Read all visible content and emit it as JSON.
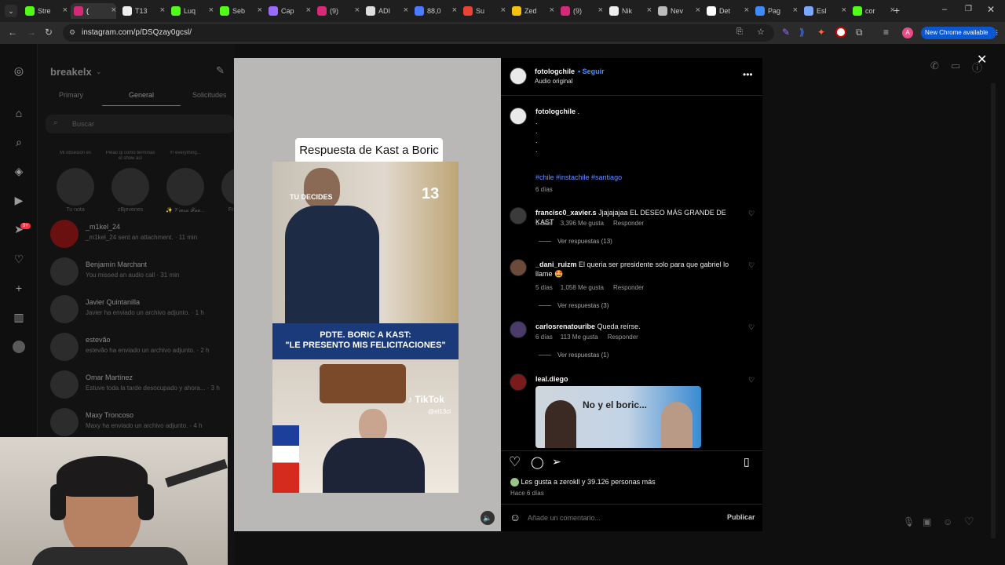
{
  "browser": {
    "tabs": [
      {
        "label": "Stre",
        "color": "#53fc18"
      },
      {
        "label": "(",
        "color": "#d62976",
        "active": true
      },
      {
        "label": "T13",
        "color": "#eeeeee"
      },
      {
        "label": "Luq",
        "color": "#53fc18"
      },
      {
        "label": "Seb",
        "color": "#53fc18"
      },
      {
        "label": "Cap",
        "color": "#9b6bff"
      },
      {
        "label": "(9)",
        "color": "#d62976"
      },
      {
        "label": "ADI",
        "color": "#dddddd"
      },
      {
        "label": "88,0",
        "color": "#4b7bff"
      },
      {
        "label": "Su",
        "color": "#ea4335"
      },
      {
        "label": "Zed",
        "color": "#f4c20d"
      },
      {
        "label": "(9)",
        "color": "#d62976"
      },
      {
        "label": "Nik",
        "color": "#eeeeee"
      },
      {
        "label": "Nev",
        "color": "#bbbbbb"
      },
      {
        "label": "Det",
        "color": "#ffffff"
      },
      {
        "label": "Pag",
        "color": "#3d8bfd"
      },
      {
        "label": "Esl",
        "color": "#7aa7ff"
      },
      {
        "label": "cor",
        "color": "#53fc18"
      }
    ],
    "url": "instagram.com/p/DSQzay0gcsl/",
    "new_chrome": "New Chrome available",
    "profile_initial": "A"
  },
  "inbox": {
    "account": "breakelx",
    "tabs": [
      "Primary",
      "General",
      "Solicitudes"
    ],
    "search_placeholder": "Buscar",
    "notes": [
      {
        "note": "Mi obsesión es",
        "name": "Tu nota"
      },
      {
        "note": "Pelao qi como terminas el show así",
        "name": "zBjevenes"
      },
      {
        "note": "!!! everything...",
        "name": "✨ 𝓥𝓲𝓮𝓻𝓪 𝓕𝓪𝓮..."
      },
      {
        "note": "Soy u",
        "name": "Francisco"
      }
    ],
    "conversations": [
      {
        "name": "_m1kel_24",
        "msg": "_m1kel_24 sent an attachment. · 11 min"
      },
      {
        "name": "Benjamín Marchant",
        "msg": "You missed an audio call · 31 min"
      },
      {
        "name": "Javier Quintanilla",
        "msg": "Javier ha enviado un archivo adjunto. · 1 h"
      },
      {
        "name": "estevão",
        "msg": "estevão ha enviado un archivo adjunto. · 2 h"
      },
      {
        "name": "Omar Martínez",
        "msg": "Estuve toda la tarde desocupado y ahora... · 3 h"
      },
      {
        "name": "Maxy Troncoso",
        "msg": "Maxy ha enviado un archivo adjunto. · 4 h"
      }
    ],
    "rail_badge": "9+"
  },
  "video": {
    "title": "Respuesta de Kast a Boric",
    "banner": "PDTE. BORIC A KAST:\n\"LE PRESENTO MIS FELICITACIONES\"",
    "logo_top": "TU DECIDES",
    "channel_num": "13",
    "tiktok": "TikTok",
    "tiktok_handle": "@el13cl"
  },
  "post": {
    "author": "fotologchile",
    "follow": "Seguir",
    "audio": "Audio original",
    "caption_user": "fotologchile",
    "caption_text": ".",
    "caption_dots": [
      ".",
      ".",
      ".",
      "."
    ],
    "hashtags": "#chile #instachile #santiago",
    "caption_time": "6 días",
    "comments": [
      {
        "user": "francisc0_xavier.s",
        "text": "Jjajajajaa EL DESEO MÁS GRANDE DE KAST",
        "time": "6 días",
        "likes": "3,396 Me gusta",
        "reply": "Responder",
        "view": "Ver respuestas (13)"
      },
      {
        "user": "_dani_ruizm",
        "text": "El queria ser presidente solo para que gabriel lo llame",
        "emoji": "🤩",
        "time": "5 días",
        "likes": "1,058 Me gusta",
        "reply": "Responder",
        "view": "Ver respuestas (3)"
      },
      {
        "user": "carlosrenatouribe",
        "text": "Queda reírse.",
        "time": "6 días",
        "likes": "113 Me gusta",
        "reply": "Responder",
        "view": "Ver respuestas (1)"
      },
      {
        "user": "leal.diego",
        "image_text": "No y el boric..."
      }
    ],
    "likes_text": "Les gusta a zerokll y 39.126 personas más",
    "likes_user": "zerokll",
    "likes_count": "39.126",
    "posted": "Hace 6 días",
    "comment_placeholder": "Añade un comentario...",
    "publish": "Publicar"
  }
}
